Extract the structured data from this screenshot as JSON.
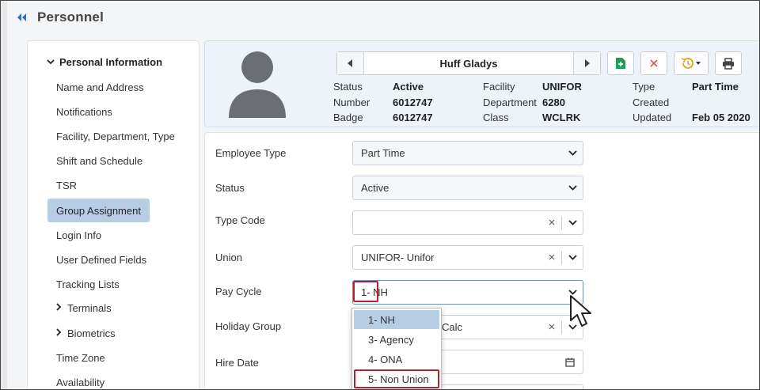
{
  "page": {
    "title": "Personnel"
  },
  "sidebar": {
    "section_label": "Personal Information",
    "items": [
      {
        "label": "Name and Address"
      },
      {
        "label": "Notifications"
      },
      {
        "label": "Facility, Department, Type"
      },
      {
        "label": "Shift and Schedule"
      },
      {
        "label": "TSR"
      },
      {
        "label": "Group Assignment",
        "active": true
      },
      {
        "label": "Login Info"
      },
      {
        "label": "User Defined Fields"
      },
      {
        "label": "Tracking Lists"
      },
      {
        "label": "Terminals",
        "expandable": true
      },
      {
        "label": "Biometrics",
        "expandable": true
      },
      {
        "label": "Time Zone"
      },
      {
        "label": "Availability"
      }
    ]
  },
  "employee": {
    "name": "Huff Gladys",
    "status_label": "Status",
    "status_value": "Active",
    "number_label": "Number",
    "number_value": "6012747",
    "badge_label": "Badge",
    "badge_value": "6012747",
    "facility_label": "Facility",
    "facility_value": "UNIFOR",
    "department_label": "Department",
    "department_value": "6280",
    "class_label": "Class",
    "class_value": "WCLRK",
    "type_label": "Type",
    "type_value": "Part Time",
    "created_label": "Created",
    "created_value": "",
    "updated_label": "Updated",
    "updated_value": "Feb 05 2020"
  },
  "toolbar": {
    "icons": [
      "previous-icon",
      "next-icon",
      "new-document-icon",
      "close-icon",
      "history-icon",
      "print-icon"
    ],
    "colors": {
      "new": "#1a9e5a",
      "delete": "#d9534f",
      "history": "#e0a020"
    }
  },
  "form": {
    "employee_type": {
      "label": "Employee Type",
      "value": "Part Time"
    },
    "status": {
      "label": "Status",
      "value": "Active"
    },
    "type_code": {
      "label": "Type Code",
      "value": ""
    },
    "union": {
      "label": "Union",
      "value": "UNIFOR- Unifor"
    },
    "pay_cycle": {
      "label": "Pay Cycle",
      "value": "1- NH"
    },
    "holiday_group": {
      "label": "Holiday Group",
      "value": "Calc"
    },
    "hire_date": {
      "label": "Hire Date",
      "value": ""
    }
  },
  "pay_cycle_options": [
    {
      "label": "1- NH",
      "selected": true
    },
    {
      "label": "3- Agency"
    },
    {
      "label": "4- ONA"
    },
    {
      "label": "5- Non Union",
      "highlighted": true
    }
  ],
  "colors": {
    "accent": "#3b6db3",
    "selection": "#b7cde4",
    "callout": "#b3222f",
    "header_bg": "#eef3fa"
  }
}
